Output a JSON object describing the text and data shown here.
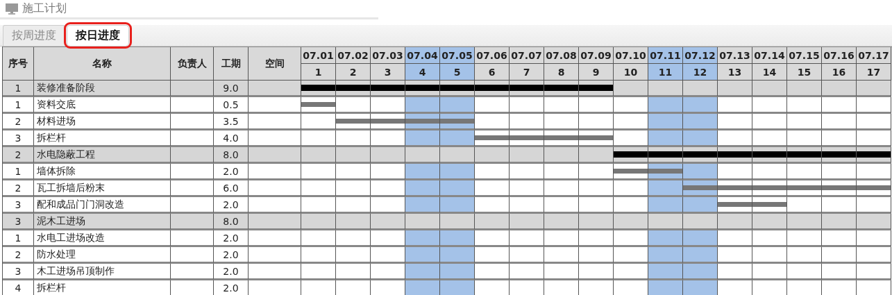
{
  "panel": {
    "title": "施工计划"
  },
  "tabs": [
    {
      "label": "按周进度",
      "selected": false,
      "highlighted": false
    },
    {
      "label": "按日进度",
      "selected": true,
      "highlighted": true
    }
  ],
  "table": {
    "columns": [
      "序号",
      "名称",
      "负责人",
      "工期",
      "空间"
    ],
    "days": [
      {
        "date": "07.01",
        "day": "1",
        "weekend": false
      },
      {
        "date": "07.02",
        "day": "2",
        "weekend": false
      },
      {
        "date": "07.03",
        "day": "3",
        "weekend": false
      },
      {
        "date": "07.04",
        "day": "4",
        "weekend": true
      },
      {
        "date": "07.05",
        "day": "5",
        "weekend": true
      },
      {
        "date": "07.06",
        "day": "6",
        "weekend": false
      },
      {
        "date": "07.07",
        "day": "7",
        "weekend": false
      },
      {
        "date": "07.08",
        "day": "8",
        "weekend": false
      },
      {
        "date": "07.09",
        "day": "9",
        "weekend": false
      },
      {
        "date": "07.10",
        "day": "10",
        "weekend": false
      },
      {
        "date": "07.11",
        "day": "11",
        "weekend": true
      },
      {
        "date": "07.12",
        "day": "12",
        "weekend": true
      },
      {
        "date": "07.13",
        "day": "13",
        "weekend": false
      },
      {
        "date": "07.14",
        "day": "14",
        "weekend": false
      },
      {
        "date": "07.15",
        "day": "15",
        "weekend": false
      },
      {
        "date": "07.16",
        "day": "16",
        "weekend": false
      },
      {
        "date": "07.17",
        "day": "17",
        "weekend": false
      }
    ],
    "rows": [
      {
        "kind": "summary",
        "seq": "1",
        "name": "装修准备阶段",
        "duration": "9.0",
        "bar_days": [
          true,
          true,
          true,
          true,
          true,
          true,
          true,
          true,
          true,
          false,
          false,
          false,
          false,
          false,
          false,
          false,
          false
        ]
      },
      {
        "kind": "task",
        "seq": "1",
        "name": "资料交底",
        "duration": "0.5",
        "bar_days": [
          true,
          false,
          false,
          false,
          false,
          false,
          false,
          false,
          false,
          false,
          false,
          false,
          false,
          false,
          false,
          false,
          false
        ]
      },
      {
        "kind": "task",
        "seq": "2",
        "name": "材料进场",
        "duration": "3.5",
        "bar_days": [
          false,
          true,
          true,
          true,
          true,
          false,
          false,
          false,
          false,
          false,
          false,
          false,
          false,
          false,
          false,
          false,
          false
        ]
      },
      {
        "kind": "task",
        "seq": "3",
        "name": "拆栏杆",
        "duration": "4.0",
        "bar_days": [
          false,
          false,
          false,
          false,
          false,
          true,
          true,
          true,
          true,
          false,
          false,
          false,
          false,
          false,
          false,
          false,
          false
        ]
      },
      {
        "kind": "summary",
        "seq": "2",
        "name": "水电隐蔽工程",
        "duration": "8.0",
        "bar_days": [
          false,
          false,
          false,
          false,
          false,
          false,
          false,
          false,
          false,
          true,
          true,
          true,
          true,
          true,
          true,
          true,
          true
        ]
      },
      {
        "kind": "task",
        "seq": "1",
        "name": "墙体拆除",
        "duration": "2.0",
        "bar_days": [
          false,
          false,
          false,
          false,
          false,
          false,
          false,
          false,
          false,
          true,
          true,
          false,
          false,
          false,
          false,
          false,
          false
        ]
      },
      {
        "kind": "task",
        "seq": "2",
        "name": "瓦工拆墙后粉末",
        "duration": "6.0",
        "bar_days": [
          false,
          false,
          false,
          false,
          false,
          false,
          false,
          false,
          false,
          false,
          false,
          true,
          true,
          true,
          true,
          true,
          true
        ]
      },
      {
        "kind": "task",
        "seq": "3",
        "name": "配和成品门门洞改造",
        "duration": "2.0",
        "bar_days": [
          false,
          false,
          false,
          false,
          false,
          false,
          false,
          false,
          false,
          false,
          false,
          false,
          true,
          true,
          false,
          false,
          false
        ]
      },
      {
        "kind": "summary",
        "seq": "3",
        "name": "泥木工进场",
        "duration": "8.0"
      },
      {
        "kind": "task",
        "seq": "1",
        "name": "水电工进场改造",
        "duration": "2.0"
      },
      {
        "kind": "task",
        "seq": "2",
        "name": "防水处理",
        "duration": "2.0"
      },
      {
        "kind": "task",
        "seq": "3",
        "name": "木工进场吊顶制作",
        "duration": "2.0"
      },
      {
        "kind": "task",
        "seq": "4",
        "name": "拆栏杆",
        "duration": "2.0"
      }
    ]
  }
}
